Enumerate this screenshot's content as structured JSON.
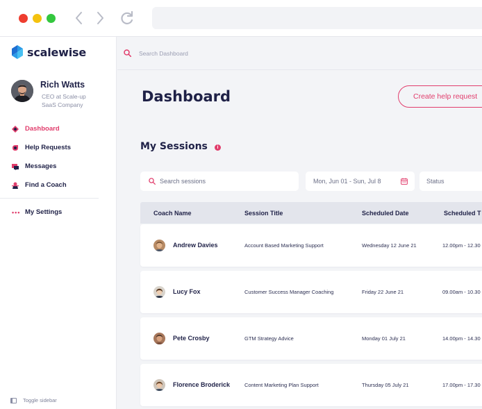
{
  "sidebar": {
    "brand": "scalewise",
    "user": {
      "name": "Rich Watts",
      "role": "CEO at Scale-up SaaS Company"
    },
    "menu": [
      {
        "label": "Dashboard",
        "icon": "dashboard-diamond-icon",
        "active": true
      },
      {
        "label": "Help Requests",
        "icon": "help-requests-icon",
        "active": false
      },
      {
        "label": "Messages",
        "icon": "messages-icon",
        "active": false
      },
      {
        "label": "Find a Coach",
        "icon": "find-coach-icon",
        "active": false
      }
    ],
    "settings_label": "My Settings",
    "toggle_label": "Toggle sidebar"
  },
  "topbar": {
    "search_placeholder": "Search Dashboard"
  },
  "page": {
    "title": "Dashboard",
    "create_button": "Create help request"
  },
  "sessions": {
    "title": "My Sessions",
    "search_placeholder": "Search sessions",
    "date_range": "Mon, Jun 01 - Sun, Jul 8",
    "status_label": "Status",
    "columns": [
      "Coach Name",
      "Session Title",
      "Scheduled Date",
      "Scheduled T"
    ],
    "rows": [
      {
        "coach": "Andrew Davies",
        "title": "Account Based Marketing Support",
        "date": "Wednesday 12 June 21",
        "time": "12.00pm - 12.30"
      },
      {
        "coach": "Lucy Fox",
        "title": "Customer Success Manager Coaching",
        "date": "Friday 22 June 21",
        "time": "09.00am - 10.30"
      },
      {
        "coach": "Pete Crosby",
        "title": "GTM Strategy Advice",
        "date": "Monday 01 July 21",
        "time": "14.00pm - 14.30"
      },
      {
        "coach": "Florence Broderick",
        "title": "Content Marketing Plan Support",
        "date": "Thursday 05 July 21",
        "time": "17.00pm - 17.30"
      }
    ]
  },
  "colors": {
    "accent": "#e13d6c",
    "navy": "#1f2147",
    "background": "#f3f4f7"
  }
}
